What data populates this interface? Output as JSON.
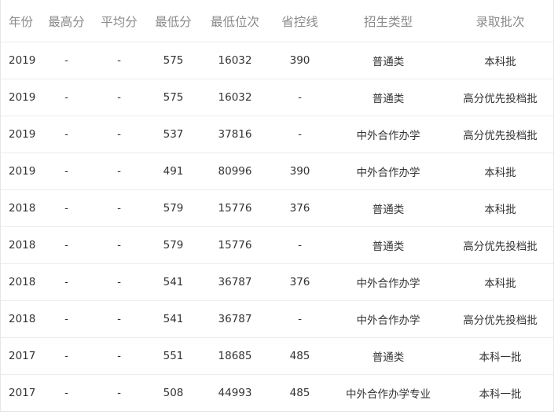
{
  "table": {
    "headers": [
      "年份",
      "最高分",
      "平均分",
      "最低分",
      "最低位次",
      "省控线",
      "招生类型",
      "录取批次"
    ],
    "rows": [
      [
        "2019",
        "-",
        "-",
        "575",
        "16032",
        "390",
        "普通类",
        "本科批"
      ],
      [
        "2019",
        "-",
        "-",
        "575",
        "16032",
        "-",
        "普通类",
        "高分优先投档批"
      ],
      [
        "2019",
        "-",
        "-",
        "537",
        "37816",
        "-",
        "中外合作办学",
        "高分优先投档批"
      ],
      [
        "2019",
        "-",
        "-",
        "491",
        "80996",
        "390",
        "中外合作办学",
        "本科批"
      ],
      [
        "2018",
        "-",
        "-",
        "579",
        "15776",
        "376",
        "普通类",
        "本科批"
      ],
      [
        "2018",
        "-",
        "-",
        "579",
        "15776",
        "-",
        "普通类",
        "高分优先投档批"
      ],
      [
        "2018",
        "-",
        "-",
        "541",
        "36787",
        "376",
        "中外合作办学",
        "本科批"
      ],
      [
        "2018",
        "-",
        "-",
        "541",
        "36787",
        "-",
        "中外合作办学",
        "高分优先投档批"
      ],
      [
        "2017",
        "-",
        "-",
        "551",
        "18685",
        "485",
        "普通类",
        "本科一批"
      ],
      [
        "2017",
        "-",
        "-",
        "508",
        "44993",
        "485",
        "中外合作办学专业",
        "本科一批"
      ]
    ]
  }
}
